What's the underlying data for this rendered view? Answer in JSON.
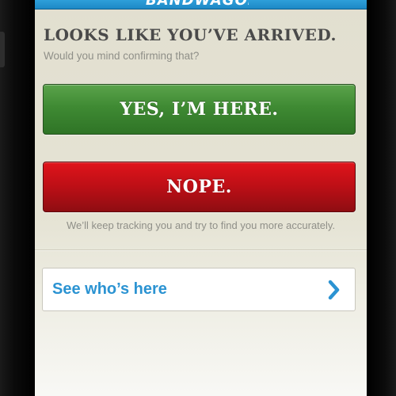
{
  "header": {
    "logo_text": "BANDWAGON",
    "color": "#2b9ad6"
  },
  "main": {
    "headline": "LOOKS LIKE YOU’VE ARRIVED.",
    "subtitle": "Would you mind confirming that?",
    "yes_button_label": "YES, I’M HERE.",
    "nope_button_label": "NOPE.",
    "tracking_note": "We’ll keep tracking you and try to find you more accurately.",
    "see_who_label": "See who’s here"
  },
  "colors": {
    "accent_blue": "#2b93d2",
    "yes_green": "#3f8a33",
    "nope_red": "#bc0f16",
    "text_gray": "#4a4a4a"
  },
  "icons": {
    "row_chevron": "chevron-right-icon"
  }
}
